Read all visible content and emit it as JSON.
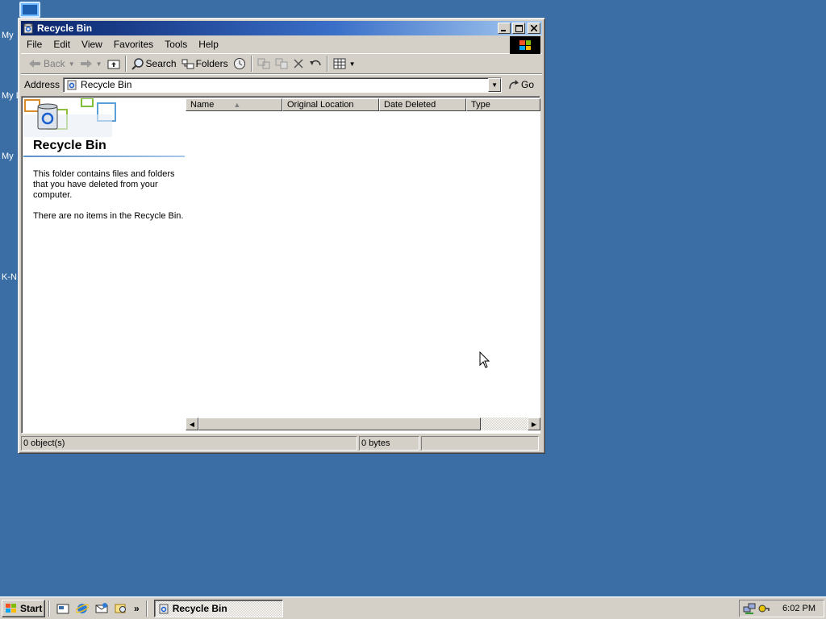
{
  "desktop": {
    "labels": [
      "My",
      "My D",
      "My",
      "K-N"
    ]
  },
  "window": {
    "title": "Recycle Bin",
    "menu": [
      "File",
      "Edit",
      "View",
      "Favorites",
      "Tools",
      "Help"
    ],
    "toolbar": {
      "back": "Back",
      "search": "Search",
      "folders": "Folders"
    },
    "address": {
      "label": "Address",
      "value": "Recycle Bin",
      "go": "Go"
    },
    "left_pane": {
      "heading": "Recycle Bin",
      "description": "This folder contains files and folders that you have deleted from your computer.",
      "empty_text": "There are no items in the Recycle Bin."
    },
    "columns": [
      "Name",
      "Original Location",
      "Date Deleted",
      "Type"
    ],
    "status": {
      "objects": "0 object(s)",
      "size": "0 bytes"
    }
  },
  "taskbar": {
    "start": "Start",
    "task": "Recycle Bin",
    "chevron": "»",
    "clock": "6:02 PM"
  }
}
